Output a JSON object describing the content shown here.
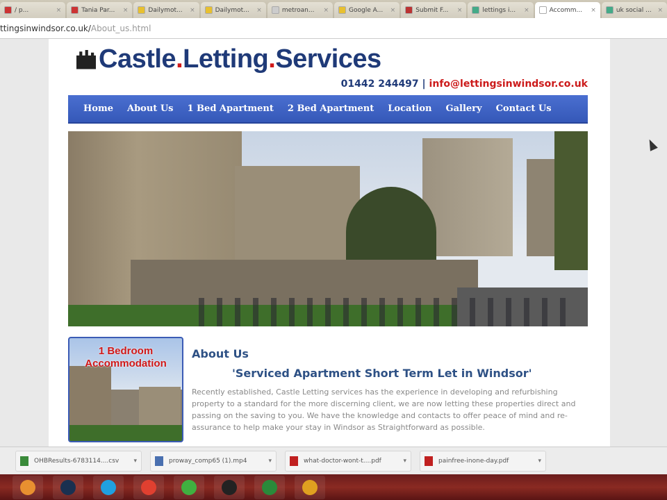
{
  "browser": {
    "tabs": [
      {
        "label": "/ p...",
        "color": "#c33"
      },
      {
        "label": "Tania Par...",
        "color": "#c33"
      },
      {
        "label": "Dailymot...",
        "color": "#e8c030"
      },
      {
        "label": "Dailymot...",
        "color": "#e8c030"
      },
      {
        "label": "metroan...",
        "color": "#ccc"
      },
      {
        "label": "Google A...",
        "color": "#e8c030"
      },
      {
        "label": "Submit F...",
        "color": "#b33"
      },
      {
        "label": "lettings i...",
        "color": "#4a8"
      },
      {
        "label": "Accomm...",
        "color": "#fff",
        "active": true
      },
      {
        "label": "uk social ...",
        "color": "#4a8"
      }
    ],
    "url_host": "ttingsinwindsor.co.uk/",
    "url_path": "About_us.html"
  },
  "site": {
    "logo": {
      "w1": "Castle",
      "w2": "Letting",
      "w3": "Services",
      "dot": "."
    },
    "phone": "01442 244497",
    "sep": " | ",
    "email": "info@lettingsinwindsor.co.uk",
    "nav": [
      "Home",
      "About Us",
      "1 Bed Apartment",
      "2 Bed Apartment",
      "Location",
      "Gallery",
      "Contact Us"
    ],
    "thumb_caption": "1 Bedroom Accommodation",
    "about_heading": "About Us",
    "about_sub": "'Serviced Apartment Short Term Let in Windsor'",
    "about_body": "Recently established, Castle Letting services has the experience in developing and refurbishing property to a standard for the more discerning client, we are now letting these properties direct and passing on the saving to you. We have the knowledge and contacts to offer peace of mind and re-assurance to help make your stay in Windsor as Straightforward as possible."
  },
  "downloads": [
    {
      "name": "OHBResults-6783114....csv",
      "color": "#3a8a3a"
    },
    {
      "name": "proway_comp65 (1).mp4",
      "color": "#4a70b0"
    },
    {
      "name": "what-doctor-wont-t....pdf",
      "color": "#c02020"
    },
    {
      "name": "painfree-inone-day.pdf",
      "color": "#c02020"
    }
  ],
  "taskbar": [
    {
      "name": "media-player",
      "color": "#e89030"
    },
    {
      "name": "hp",
      "color": "#1a3050"
    },
    {
      "name": "skype",
      "color": "#20a0e0"
    },
    {
      "name": "chrome",
      "color": "#e04030"
    },
    {
      "name": "notes",
      "color": "#40b040"
    },
    {
      "name": "webcam",
      "color": "#222"
    },
    {
      "name": "excel",
      "color": "#2a8a3a"
    },
    {
      "name": "vlc",
      "color": "#e0a020"
    }
  ]
}
